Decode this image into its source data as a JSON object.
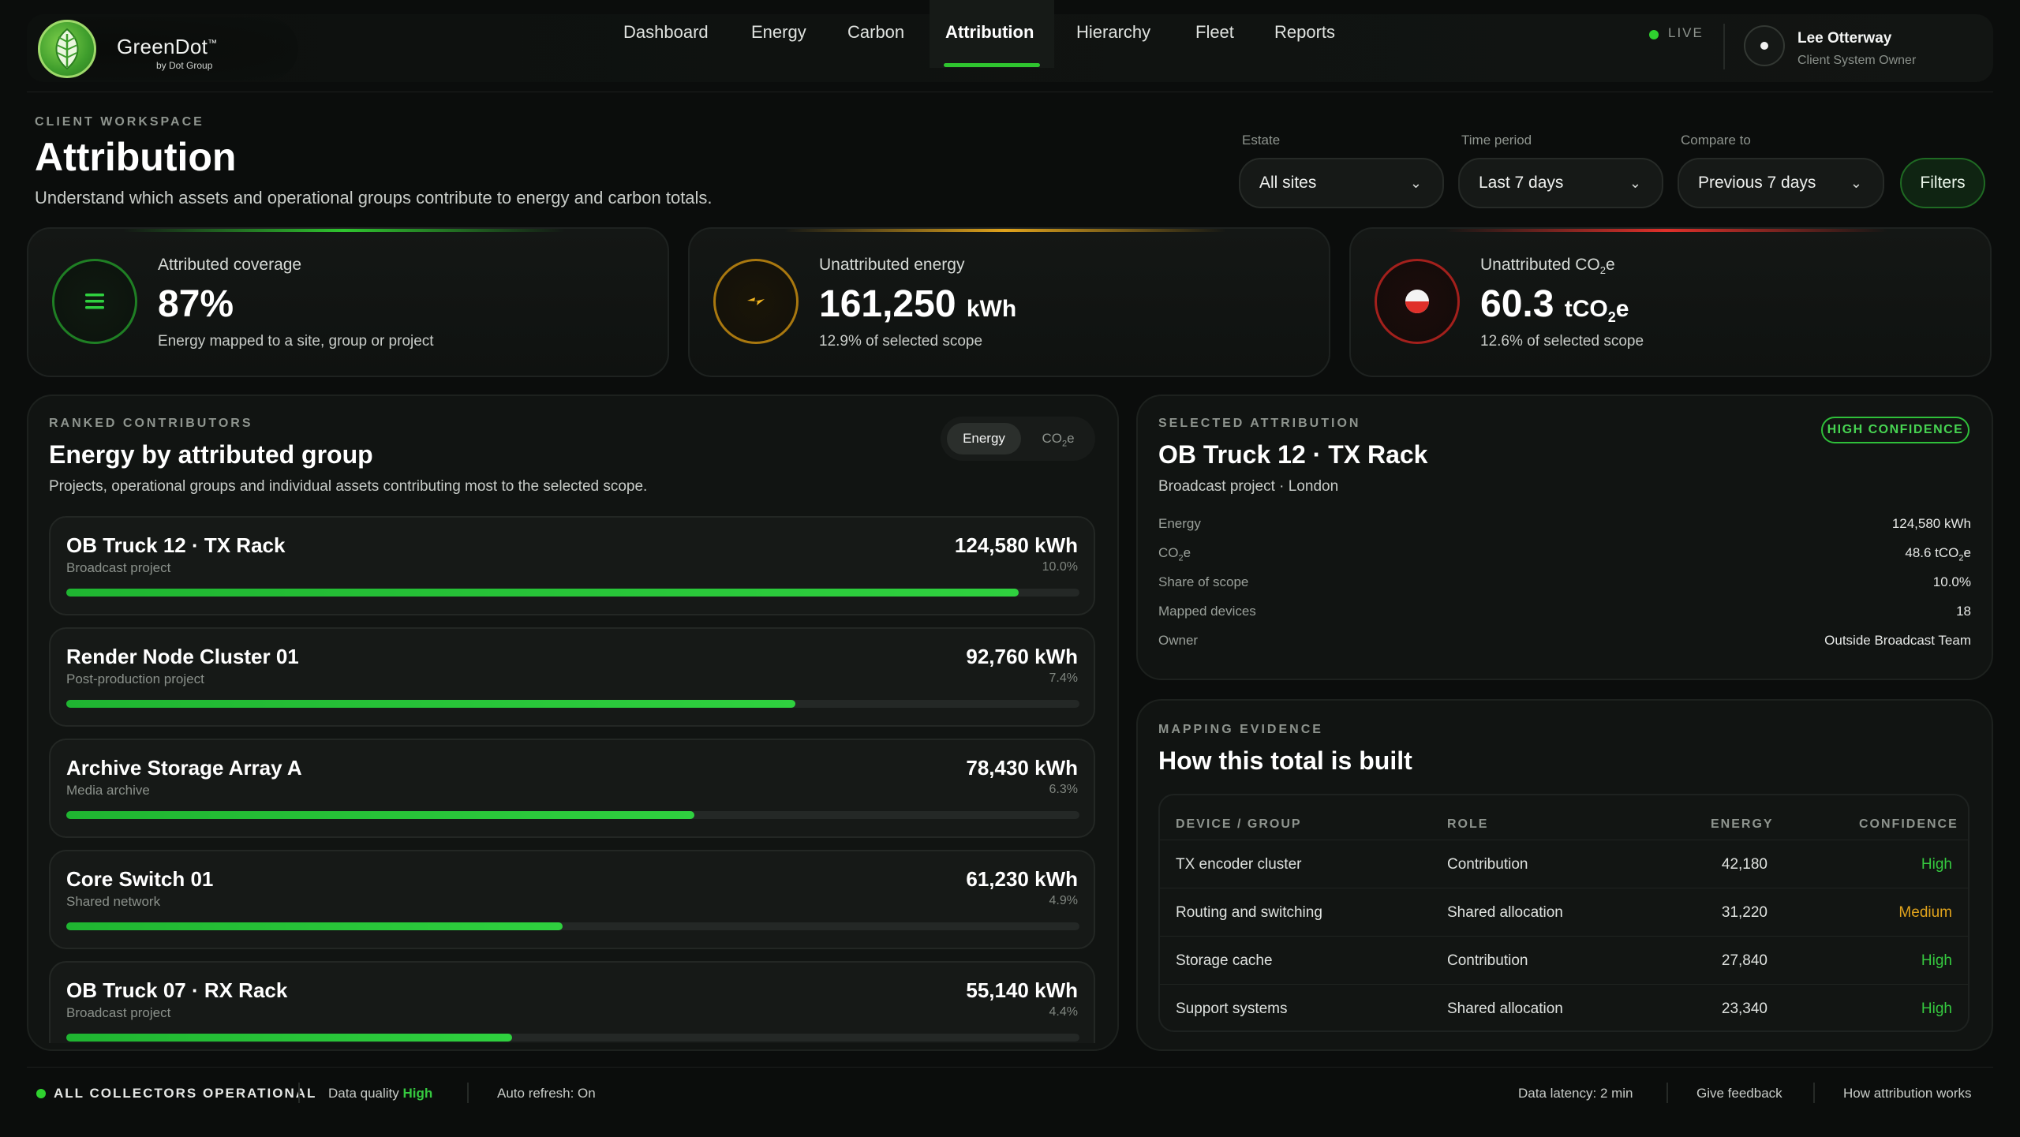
{
  "brand": {
    "name": "GreenDot",
    "trademark": "™",
    "byline": "by Dot Group"
  },
  "nav": {
    "items": [
      {
        "label": "Dashboard"
      },
      {
        "label": "Energy"
      },
      {
        "label": "Carbon"
      },
      {
        "label": "Attribution",
        "active": true
      },
      {
        "label": "Hierarchy"
      },
      {
        "label": "Fleet"
      },
      {
        "label": "Reports"
      }
    ],
    "live_label": "LIVE"
  },
  "user": {
    "name": "Lee Otterway",
    "role": "Client System Owner"
  },
  "header": {
    "eyebrow": "CLIENT WORKSPACE",
    "title": "Attribution",
    "description": "Understand which assets and operational groups contribute to energy and carbon totals."
  },
  "filters": {
    "estate": {
      "label": "Estate",
      "value": "All sites"
    },
    "time_period": {
      "label": "Time period",
      "value": "Last 7 days"
    },
    "compare_to": {
      "label": "Compare to",
      "value": "Previous 7 days"
    },
    "button_label": "Filters"
  },
  "kpis": {
    "coverage": {
      "label": "Attributed coverage",
      "value": "87%",
      "sub": "Energy mapped to a site, group or project",
      "accent": "#2fc52f"
    },
    "energy": {
      "label": "Unattributed energy",
      "value": "161,250",
      "unit": "kWh",
      "sub": "12.9% of selected scope",
      "accent": "#e0a31c"
    },
    "co2": {
      "label_main": "Unattributed CO",
      "label_sub": "2",
      "label_end": "e",
      "value": "60.3",
      "unit_main": "tCO",
      "unit_sub": "2",
      "unit_end": "e",
      "sub": "12.6% of selected scope",
      "accent": "#e0302a"
    }
  },
  "ranked": {
    "eyebrow": "RANKED CONTRIBUTORS",
    "title": "Energy by attributed group",
    "description": "Projects, operational groups and individual assets contributing most to the selected scope.",
    "toggle": {
      "on": "Energy",
      "off_main": "CO",
      "off_sub": "2",
      "off_end": "e"
    },
    "rows": [
      {
        "name": "OB Truck 12 · TX Rack",
        "type": "Broadcast project",
        "energy": "124,580 kWh",
        "pct": "10.0%",
        "fill": 0.94
      },
      {
        "name": "Render Node Cluster 01",
        "type": "Post-production project",
        "energy": "92,760 kWh",
        "pct": "7.4%",
        "fill": 0.72
      },
      {
        "name": "Archive Storage Array A",
        "type": "Media archive",
        "energy": "78,430 kWh",
        "pct": "6.3%",
        "fill": 0.62
      },
      {
        "name": "Core Switch 01",
        "type": "Shared network",
        "energy": "61,230 kWh",
        "pct": "4.9%",
        "fill": 0.49
      },
      {
        "name": "OB Truck 07 · RX Rack",
        "type": "Broadcast project",
        "energy": "55,140 kWh",
        "pct": "4.4%",
        "fill": 0.44
      }
    ]
  },
  "selected": {
    "eyebrow": "SELECTED ATTRIBUTION",
    "badge": "HIGH CONFIDENCE",
    "title": "OB Truck 12 · TX Rack",
    "subtitle": "Broadcast project · London",
    "fields": {
      "energy_label": "Energy",
      "energy_value": "124,580 kWh",
      "co2_label_main": "CO",
      "co2_label_sub": "2",
      "co2_label_end": "e",
      "co2_value_main": "48.6 tCO",
      "co2_value_sub": "2",
      "co2_value_end": "e",
      "share_label": "Share of scope",
      "share_value": "10.0%",
      "devices_label": "Mapped devices",
      "devices_value": "18",
      "owner_label": "Owner",
      "owner_value": "Outside Broadcast Team"
    }
  },
  "evidence": {
    "eyebrow": "MAPPING EVIDENCE",
    "title": "How this total is built",
    "columns": {
      "device": "DEVICE / GROUP",
      "role": "ROLE",
      "energy": "ENERGY",
      "confidence": "CONFIDENCE"
    },
    "rows": [
      {
        "device": "TX encoder cluster",
        "role": "Contribution",
        "energy": "42,180",
        "confidence": "High",
        "color": "#35c83f"
      },
      {
        "device": "Routing and switching",
        "role": "Shared allocation",
        "energy": "31,220",
        "confidence": "Medium",
        "color": "#e0a31c"
      },
      {
        "device": "Storage cache",
        "role": "Contribution",
        "energy": "27,840",
        "confidence": "High",
        "color": "#35c83f"
      },
      {
        "device": "Support systems",
        "role": "Shared allocation",
        "energy": "23,340",
        "confidence": "High",
        "color": "#35c83f"
      }
    ]
  },
  "footer": {
    "status": "ALL COLLECTORS OPERATIONAL",
    "quality_label": "Data quality",
    "quality_value": "High",
    "refresh": "Auto refresh: On",
    "latency": "Data latency: 2 min",
    "feedback": "Give feedback",
    "how": "How attribution works"
  }
}
